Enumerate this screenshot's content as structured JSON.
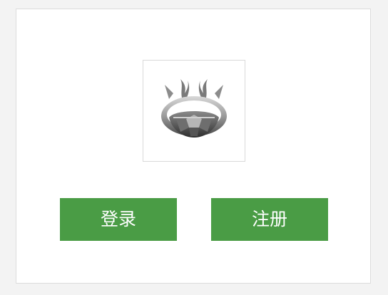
{
  "logo": {
    "icon": "antlered-crown-logo-icon"
  },
  "actions": {
    "login_label": "登录",
    "register_label": "注册"
  },
  "colors": {
    "page_background": "#f3f3f3",
    "card_background": "#ffffff",
    "button_green": "#4a9c45",
    "button_text": "#ffffff"
  }
}
